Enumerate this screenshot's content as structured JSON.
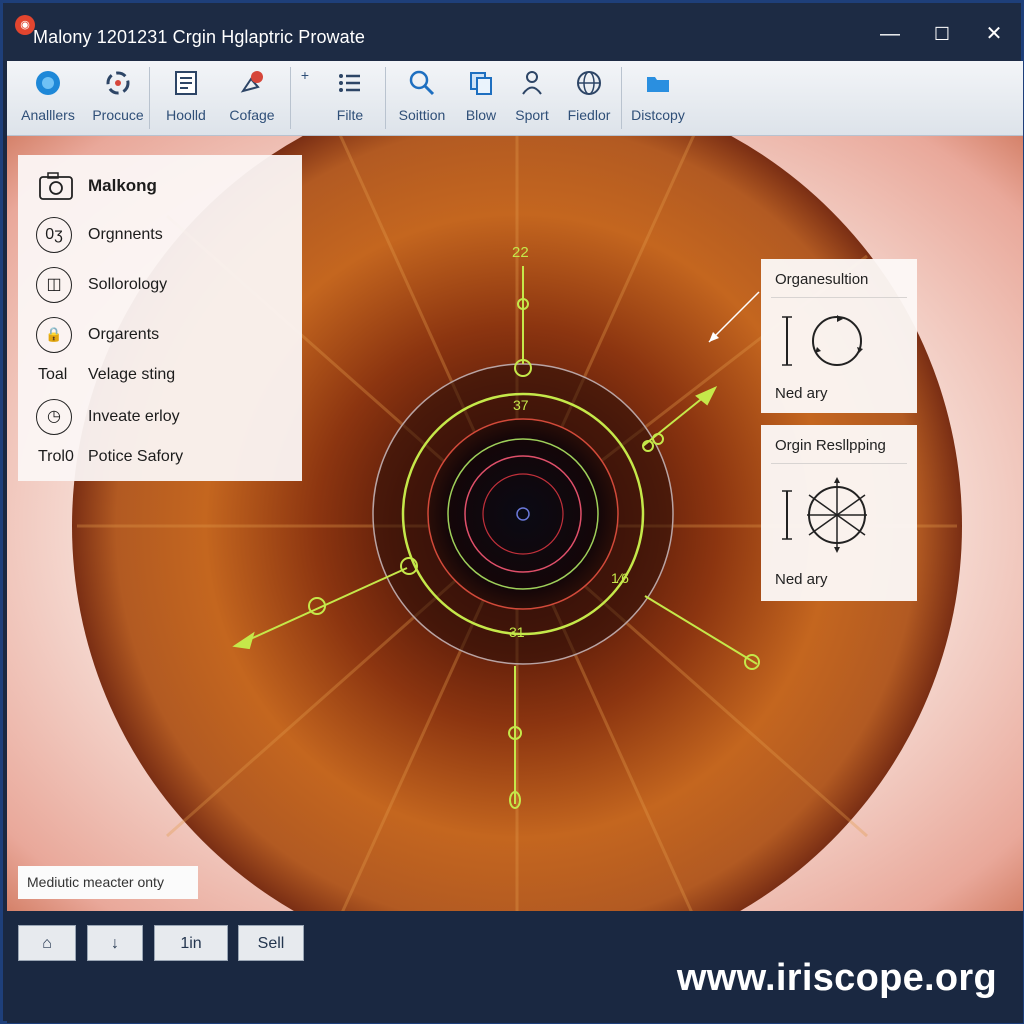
{
  "window": {
    "title": "Malony 1201231 Crgin Hglaptric Prowate",
    "minimize": "—",
    "maximize": "☐",
    "close": "✕"
  },
  "toolbar": {
    "items": [
      {
        "label": "Analllers",
        "icon": "globe-icon"
      },
      {
        "label": "Procuce",
        "icon": "cycle-icon"
      },
      {
        "label": "Hoolld",
        "icon": "document-icon"
      },
      {
        "label": "Cofage",
        "icon": "pin-icon"
      },
      {
        "label": "Filte",
        "icon": "list-icon"
      },
      {
        "label": "Soittion",
        "icon": "search-icon"
      },
      {
        "label": "Blow",
        "icon": "copy-icon"
      },
      {
        "label": "Sport",
        "icon": "person-icon"
      },
      {
        "label": "Fiedlor",
        "icon": "grid-globe-icon"
      },
      {
        "label": "Distcopy",
        "icon": "folder-icon"
      }
    ],
    "plus": "+"
  },
  "left_panel": {
    "rows": [
      {
        "label": "Malkong",
        "icon": "camera-icon"
      },
      {
        "label": "Orgnnents",
        "icon": "pill-icon",
        "glyph": "0ʒ"
      },
      {
        "label": "Sollorology",
        "icon": "book-icon",
        "glyph": "◫"
      },
      {
        "label": "Orgarents",
        "icon": "lock-icon",
        "glyph": "🔒"
      },
      {
        "label": "Velage sting",
        "prefix": "Toal"
      },
      {
        "label": "Inveate erloy",
        "icon": "clock-icon",
        "glyph": "◷"
      },
      {
        "label": "Potice Safory",
        "prefix": "Trol0"
      }
    ]
  },
  "overlay": {
    "top_label": "22",
    "ring_label_top": "37",
    "ring_label_bottom": "31",
    "right_label": "1⁄6"
  },
  "right_panels": [
    {
      "title": "Organesultion",
      "footer": "Ned ary"
    },
    {
      "title": "Orgin Resllpping",
      "footer": "Ned ary"
    }
  ],
  "note": "Mediutic meacter onty",
  "bottom_buttons": [
    {
      "label": "⌂",
      "icon": "home-icon"
    },
    {
      "label": "↓",
      "icon": "down-arrow-icon"
    },
    {
      "label": "1in"
    },
    {
      "label": "Sell"
    }
  ],
  "footer_url": "www.iriscope.org",
  "colors": {
    "accent": "#c5e84a",
    "iris": "#b8581c",
    "frame": "#1a2841"
  }
}
